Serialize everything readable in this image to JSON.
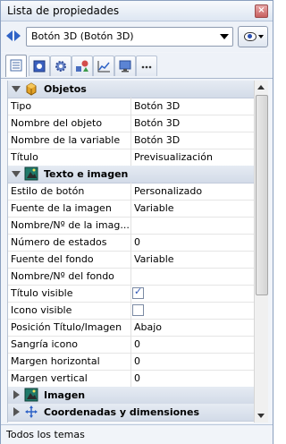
{
  "window": {
    "title": "Lista de propiedades"
  },
  "object_selector": {
    "value": "Botón 3D (Botón 3D)"
  },
  "tabs": [
    {
      "icon": "properties-list-icon",
      "active": true
    },
    {
      "icon": "object-icon",
      "active": false
    },
    {
      "icon": "gear-icon",
      "active": false
    },
    {
      "icon": "shapes-icon",
      "active": false
    },
    {
      "icon": "chart-icon",
      "active": false
    },
    {
      "icon": "monitor-icon",
      "active": false
    },
    {
      "icon": "more-icon",
      "active": false
    }
  ],
  "categories": {
    "objetos": {
      "label": "Objetos",
      "expanded": true
    },
    "texto_imagen": {
      "label": "Texto e imagen",
      "expanded": true
    },
    "imagen": {
      "label": "Imagen",
      "expanded": false
    },
    "coordenadas": {
      "label": "Coordenadas y dimensiones",
      "expanded": false
    }
  },
  "objetos_rows": [
    {
      "name": "Tipo",
      "value": "Botón 3D"
    },
    {
      "name": "Nombre del objeto",
      "value": "Botón 3D"
    },
    {
      "name": "Nombre de la variable",
      "value": "Botón 3D"
    },
    {
      "name": "Título",
      "value": "Previsualización"
    }
  ],
  "texto_rows": [
    {
      "name": "Estilo de botón",
      "value": "Personalizado"
    },
    {
      "name": "Fuente de la imagen",
      "value": "Variable"
    },
    {
      "name": "Nombre/Nº de la imag...",
      "value": ""
    },
    {
      "name": "Número de estados",
      "value": "0"
    },
    {
      "name": "Fuente del fondo",
      "value": "Variable"
    },
    {
      "name": "Nombre/Nº del fondo",
      "value": ""
    },
    {
      "name": "Título visible",
      "checked": true
    },
    {
      "name": "Icono visible",
      "checked": false
    },
    {
      "name": "Posición Título/Imagen",
      "value": "Abajo"
    },
    {
      "name": "Sangría icono",
      "value": "0"
    },
    {
      "name": "Margen horizontal",
      "value": "0"
    },
    {
      "name": "Margen vertical",
      "value": "0"
    }
  ],
  "status": {
    "text": "Todos los temas"
  },
  "colors": {
    "accent": "#2f63c7",
    "category_bg": "#d3dbe8"
  }
}
